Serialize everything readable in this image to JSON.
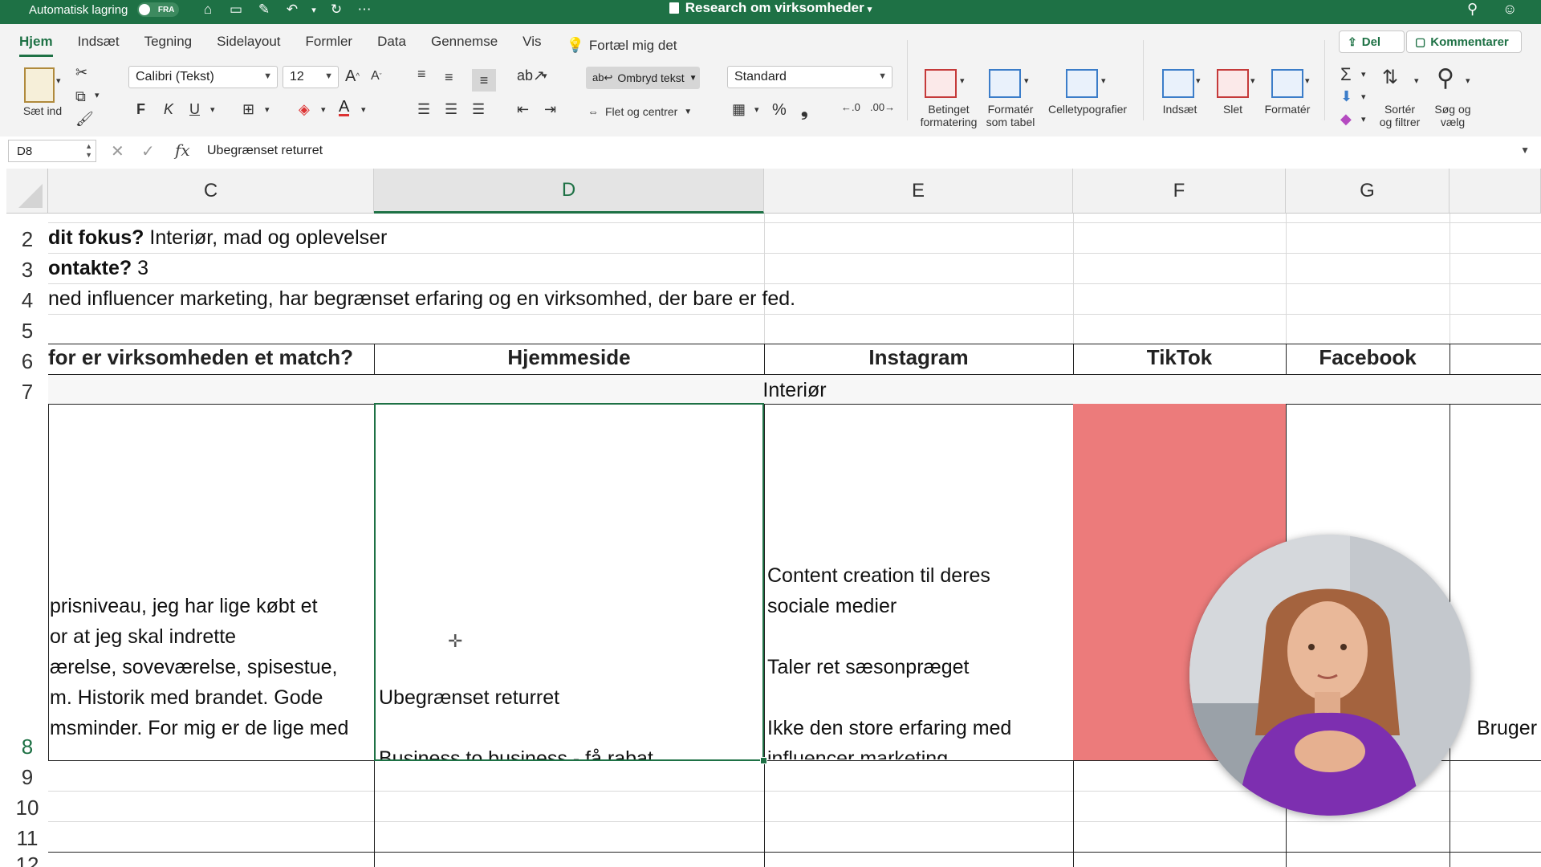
{
  "titlebar": {
    "autosave_label": "Automatisk lagring",
    "autosave_state": "FRA",
    "document_title": "Research om virksomheder",
    "icons": [
      "home-icon",
      "save-icon",
      "save-as-icon",
      "undo-icon",
      "redo-icon",
      "more-icon",
      "search-icon",
      "share-person-icon"
    ]
  },
  "ribbon": {
    "tabs": [
      "Hjem",
      "Indsæt",
      "Tegning",
      "Sidelayout",
      "Formler",
      "Data",
      "Gennemse",
      "Vis"
    ],
    "active_tab": "Hjem",
    "tell_me": "Fortæl mig det",
    "share_label": "Del",
    "comment_label": "Kommentarer",
    "paste_label": "Sæt ind",
    "font_name": "Calibri (Tekst)",
    "font_size": "12",
    "bold": "F",
    "italic": "K",
    "underline": "U",
    "wrap_text": "Ombryd tekst",
    "merge_center": "Flet og centrer",
    "number_format": "Standard",
    "percent": "%",
    "comma": "❟",
    "conditional": "Betinget\nformatering",
    "format_table": "Formatér\nsom tabel",
    "cell_styles": "Celletypografier",
    "insert": "Indsæt",
    "delete": "Slet",
    "format": "Formatér",
    "sort_filter": "Sortér\nog filtrer",
    "find_select": "Søg og\nvælg",
    "colors": {
      "accent": "#1e7145",
      "fill_red": "#ec7b7b"
    }
  },
  "formula_bar": {
    "name_box": "D8",
    "fx": "fx",
    "content": "Ubegrænset returret"
  },
  "grid": {
    "columns": [
      "C",
      "D",
      "E",
      "F",
      "G"
    ],
    "selected_column": "D",
    "rows": [
      "2",
      "3",
      "4",
      "5",
      "6",
      "7",
      "8",
      "9",
      "10",
      "11",
      "12"
    ],
    "selected_row": "8",
    "row2_bold": "dit fokus?",
    "row2_text": " Interiør, mad og oplevelser",
    "row3_bold": "ontakte?",
    "row3_text": " 3",
    "row4_text": "ned influencer marketing, har begrænset erfaring og en virksomhed, der bare er fed.",
    "row6": {
      "c": "for er virksomheden et match?",
      "d": "Hjemmeside",
      "e": "Instagram",
      "f": "TikTok",
      "g": "Facebook"
    },
    "row7": "Interiør",
    "row8": {
      "c": "prisniveau, jeg har lige købt et\nor at jeg skal indrette\nærelse, soveværelse, spisestue,\nm. Historik med brandet. Gode\nmsminder. For mig er de lige med",
      "d": "Ubegrænset returret\n\nBusiness to business - få rabat",
      "e": "Content creation til deres\nsociale medier\n\nTaler ret sæsonpræget\n\nIkke den store erfaring med\ninfluencer marketing.",
      "h": "Bruger"
    }
  }
}
